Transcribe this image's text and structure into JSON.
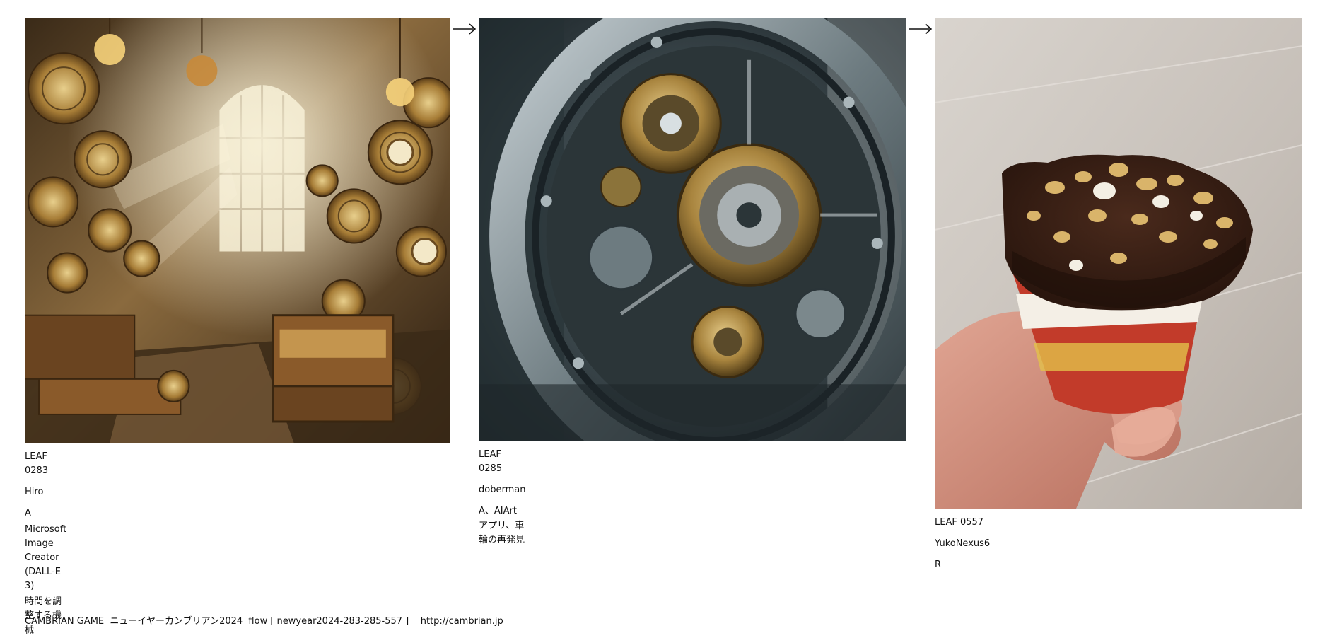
{
  "leaves": [
    {
      "id": "LEAF 0283",
      "author": "Hiro",
      "type": "A",
      "tool": "Microsoft Image Creator (DALL-E 3)",
      "title": "時間を調整する機械",
      "image_icon": "steampunk-clockwork-room-image"
    },
    {
      "id": "LEAF 0285",
      "author": "doberman",
      "type": "A、AIArtアプリ、車輪の再発見",
      "image_icon": "mechanical-wheel-gears-image"
    },
    {
      "id": "LEAF 0557",
      "author": "YukoNexus6",
      "type": "R",
      "image_icon": "chocolate-ice-cream-cone-photo"
    }
  ],
  "arrows": [
    "→",
    "→"
  ],
  "footer": {
    "text": "CAMBRIAN GAME  ニューイヤーカンブリアン2024  flow [ newyear2024-283-285-557 ]    http://cambrian.jp"
  },
  "colors": {
    "background": "#ffffff",
    "text": "#111111"
  }
}
